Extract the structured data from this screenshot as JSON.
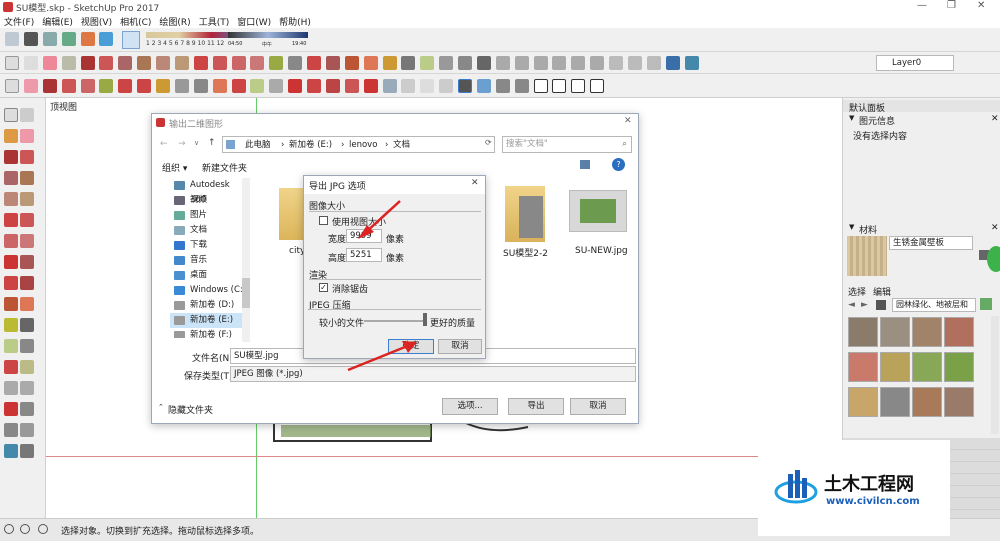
{
  "app": {
    "title": "SU模型.skp - SketchUp Pro 2017"
  },
  "menu": [
    "文件(F)",
    "编辑(E)",
    "视图(V)",
    "相机(C)",
    "绘图(R)",
    "工具(T)",
    "窗口(W)",
    "帮助(H)"
  ],
  "toolbar": {
    "shadow_months": "1 2 3 4 5 6 7 8 9 10 11 12",
    "shadow_time_start": "04:50",
    "shadow_time_mid": "中午",
    "shadow_time_end": "19:40",
    "layer_value": "Layer0"
  },
  "viewport": {
    "label": "顶视图"
  },
  "export_dialog": {
    "title": "输出二维图形",
    "breadcrumb": [
      "此电脑",
      "新加卷 (E:)",
      "lenovo",
      "文档"
    ],
    "search_placeholder": "搜索\"文档\"",
    "organize": "组织 ▾",
    "new_folder": "新建文件夹",
    "nav_items": [
      "Autodesk 360",
      "视频",
      "图片",
      "文档",
      "下载",
      "音乐",
      "桌面",
      "Windows (C:)",
      "新加卷 (D:)",
      "新加卷 (E:)",
      "新加卷 (F:)"
    ],
    "files": [
      {
        "name": "city"
      },
      {
        "name": "SU模型2-2"
      },
      {
        "name": "SU-NEW.jpg"
      }
    ],
    "filename_label": "文件名(N):",
    "filename_value": "SU模型.jpg",
    "type_label": "保存类型(T):",
    "type_value": "JPEG 图像 (*.jpg)",
    "hide_folders": "隐藏文件夹",
    "options_btn": "选项...",
    "export_btn": "导出",
    "cancel_btn": "取消"
  },
  "jpg_dialog": {
    "title": "导出 JPG 选项",
    "image_size": "图像大小",
    "use_view_size": "使用视图大小",
    "width_label": "宽度:",
    "width_value": "9999",
    "width_unit": "像素",
    "height_label": "高度:",
    "height_value": "5251",
    "height_unit": "像素",
    "render": "渲染",
    "antialias": "消除锯齿",
    "jpeg_compress": "JPEG 压缩",
    "smaller": "较小的文件",
    "better": "更好的质量",
    "ok": "确定",
    "cancel": "取消"
  },
  "right_panel": {
    "tray": "默认面板",
    "entity_info": "图元信息",
    "no_selection": "没有选择内容",
    "materials": "材料",
    "material_name": "生锈金属壁板",
    "tab_select": "选择",
    "tab_edit": "编辑",
    "library": "园林绿化、地被层和"
  },
  "status": {
    "text": "选择对象。切换到扩充选择。拖动鼠标选择多项。"
  },
  "watermark": {
    "name": "土木工程网",
    "url": "www.civilcn.com"
  }
}
